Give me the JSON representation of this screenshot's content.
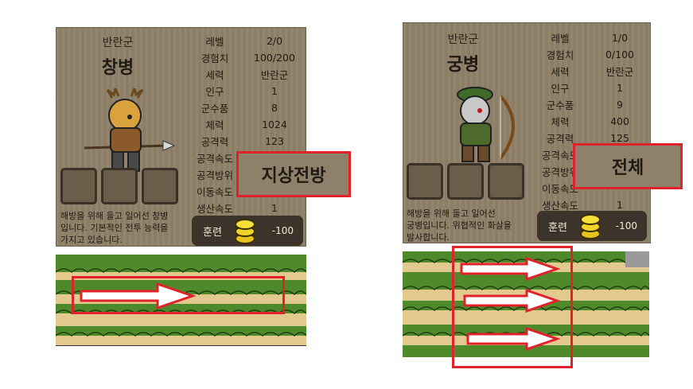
{
  "left": {
    "faction": "반란군",
    "unit_name": "창병",
    "stats": [
      {
        "label": "레벨",
        "value": "2/0"
      },
      {
        "label": "경험치",
        "value": "100/200"
      },
      {
        "label": "세력",
        "value": "반란군"
      },
      {
        "label": "인구",
        "value": "1"
      },
      {
        "label": "군수품",
        "value": "8"
      },
      {
        "label": "체력",
        "value": "1024"
      },
      {
        "label": "공격력",
        "value": "123"
      },
      {
        "label": "공격속도",
        "value": ""
      },
      {
        "label": "공격방위",
        "value": ""
      },
      {
        "label": "이동속도",
        "value": ""
      },
      {
        "label": "생산속도",
        "value": "1"
      }
    ],
    "description_lines": [
      "해방을 위해 들고 일어선 창병",
      "입니다. 기본적인 전투 능력을",
      "가지고 있습니다."
    ],
    "train_label": "훈련",
    "train_cost": "-100",
    "popup_text": "지상전방"
  },
  "right": {
    "faction": "반란군",
    "unit_name": "궁병",
    "stats": [
      {
        "label": "레벨",
        "value": "1/0"
      },
      {
        "label": "경험치",
        "value": "0/100"
      },
      {
        "label": "세력",
        "value": "반란군"
      },
      {
        "label": "인구",
        "value": "1"
      },
      {
        "label": "군수품",
        "value": "9"
      },
      {
        "label": "체력",
        "value": "400"
      },
      {
        "label": "공격력",
        "value": "125"
      },
      {
        "label": "공격속도",
        "value": ""
      },
      {
        "label": "공격방위",
        "value": ""
      },
      {
        "label": "이동속도",
        "value": ""
      },
      {
        "label": "생산속도",
        "value": "1"
      }
    ],
    "description_lines": [
      "해방을 위해 들고 일어선",
      "궁병입니다. 위협적인 화살을",
      "발사합니다."
    ],
    "train_label": "훈련",
    "train_cost": "-100",
    "popup_text": "전체"
  },
  "colors": {
    "highlight": "#e0232b",
    "panel": "#8f8169",
    "button": "#3c332a",
    "grass": "#4f8a2a",
    "dirt": "#e3c98e"
  },
  "icons": [
    "coin-stack-icon",
    "spear-icon",
    "bow-icon",
    "arrow-right-icon"
  ]
}
